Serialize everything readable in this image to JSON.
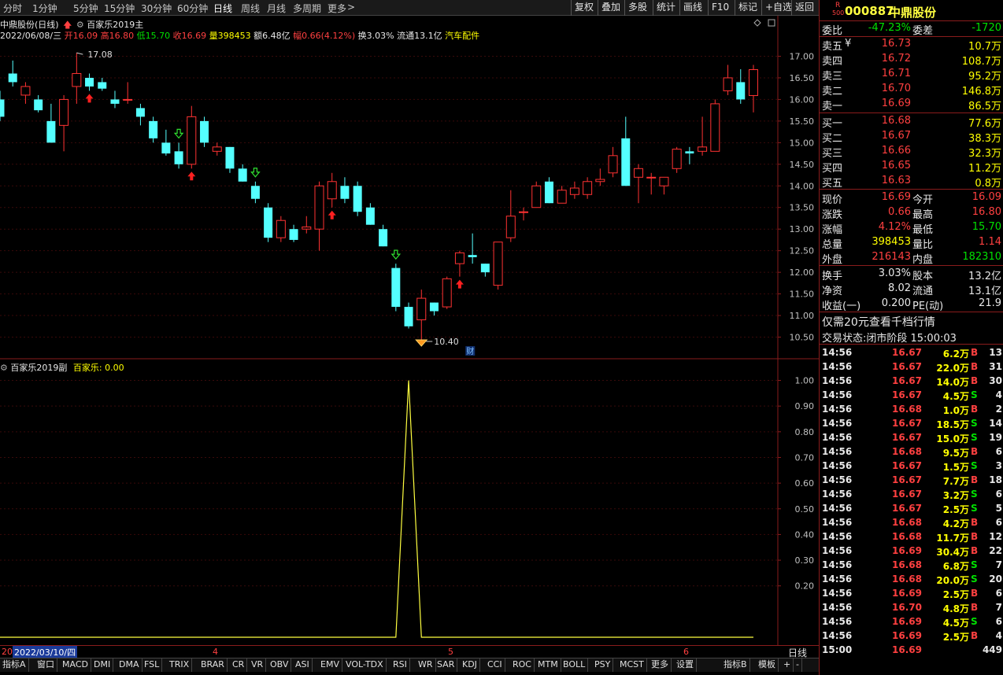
{
  "toolbar": {
    "timeframes": [
      "分时",
      "1分钟",
      "5分钟",
      "15分钟",
      "30分钟",
      "60分钟",
      "日线",
      "周线",
      "月线",
      "多周期",
      "更多"
    ],
    "active": "日线",
    "more_arrow": ">",
    "right_buttons": [
      "复权",
      "叠加",
      "多股",
      "统计",
      "画线",
      "F10",
      "标记",
      "+自选",
      "返回"
    ]
  },
  "info": {
    "title": "中鼎股份(日线)",
    "indicator_main": "百家乐2019主",
    "date": "2022/06/08/三",
    "open": "开16.09",
    "high": "高16.80",
    "low": "低15.70",
    "close": "收16.69",
    "volume": "量398453",
    "amount": "额6.48亿",
    "amplitude": "幅0.66(4.12%)",
    "turnover": "换3.03%",
    "float": "流通13.1亿",
    "sector": "汽车配件"
  },
  "chart_data": [
    {
      "type": "candlestick",
      "y_axis_labels": [
        "17.00",
        "16.50",
        "16.00",
        "15.50",
        "15.00",
        "14.50",
        "14.00",
        "13.50",
        "13.00",
        "12.50",
        "12.00",
        "11.50",
        "11.00",
        "10.50"
      ],
      "ylim": [
        10.2,
        17.3
      ],
      "annotations": {
        "high_label": "17.08",
        "low_label": "10.40",
        "fin_marker": "财"
      },
      "colors": {
        "up": "#ff3232",
        "down": "#54ffff"
      },
      "candles": [
        {
          "o": 16.0,
          "h": 16.2,
          "l": 15.5,
          "c": 15.6
        },
        {
          "o": 16.6,
          "h": 16.9,
          "l": 16.3,
          "c": 16.4
        },
        {
          "o": 16.1,
          "h": 16.4,
          "l": 15.9,
          "c": 16.3
        },
        {
          "o": 16.0,
          "h": 16.1,
          "l": 15.7,
          "c": 15.75
        },
        {
          "o": 15.5,
          "h": 15.9,
          "l": 15.0,
          "c": 15.0
        },
        {
          "o": 15.4,
          "h": 16.1,
          "l": 14.8,
          "c": 16.0
        },
        {
          "o": 16.3,
          "h": 17.08,
          "l": 15.9,
          "c": 16.6
        },
        {
          "o": 16.5,
          "h": 16.6,
          "l": 16.2,
          "c": 16.3
        },
        {
          "o": 16.4,
          "h": 16.5,
          "l": 16.2,
          "c": 16.25
        },
        {
          "o": 16.0,
          "h": 16.2,
          "l": 15.8,
          "c": 15.9
        },
        {
          "o": 16.0,
          "h": 16.4,
          "l": 15.9,
          "c": 16.0
        },
        {
          "o": 15.8,
          "h": 15.9,
          "l": 15.4,
          "c": 15.6
        },
        {
          "o": 15.5,
          "h": 15.6,
          "l": 15.0,
          "c": 15.1
        },
        {
          "o": 15.0,
          "h": 15.3,
          "l": 14.7,
          "c": 14.75
        },
        {
          "o": 14.8,
          "h": 15.0,
          "l": 14.4,
          "c": 14.5
        },
        {
          "o": 14.5,
          "h": 15.85,
          "l": 14.4,
          "c": 15.6
        },
        {
          "o": 15.5,
          "h": 15.6,
          "l": 14.9,
          "c": 15.0
        },
        {
          "o": 14.8,
          "h": 15.0,
          "l": 14.7,
          "c": 14.9
        },
        {
          "o": 14.9,
          "h": 14.9,
          "l": 14.3,
          "c": 14.4
        },
        {
          "o": 14.4,
          "h": 14.5,
          "l": 14.1,
          "c": 14.1
        },
        {
          "o": 14.0,
          "h": 14.1,
          "l": 13.6,
          "c": 13.7
        },
        {
          "o": 13.5,
          "h": 13.6,
          "l": 12.7,
          "c": 12.8
        },
        {
          "o": 12.8,
          "h": 13.3,
          "l": 12.7,
          "c": 13.2
        },
        {
          "o": 13.0,
          "h": 13.1,
          "l": 12.7,
          "c": 12.75
        },
        {
          "o": 13.0,
          "h": 13.3,
          "l": 12.9,
          "c": 13.05
        },
        {
          "o": 13.0,
          "h": 14.1,
          "l": 12.5,
          "c": 14.0
        },
        {
          "o": 13.7,
          "h": 14.3,
          "l": 13.5,
          "c": 14.1
        },
        {
          "o": 14.0,
          "h": 14.2,
          "l": 13.6,
          "c": 13.7
        },
        {
          "o": 14.0,
          "h": 14.1,
          "l": 13.3,
          "c": 13.4
        },
        {
          "o": 13.5,
          "h": 13.6,
          "l": 13.1,
          "c": 13.1
        },
        {
          "o": 13.0,
          "h": 13.1,
          "l": 12.6,
          "c": 12.6
        },
        {
          "o": 12.1,
          "h": 12.2,
          "l": 11.1,
          "c": 11.2
        },
        {
          "o": 11.2,
          "h": 11.3,
          "l": 10.7,
          "c": 10.75
        },
        {
          "o": 10.9,
          "h": 11.6,
          "l": 10.4,
          "c": 11.4
        },
        {
          "o": 11.3,
          "h": 11.3,
          "l": 11.0,
          "c": 11.1
        },
        {
          "o": 11.2,
          "h": 11.9,
          "l": 11.15,
          "c": 11.85
        },
        {
          "o": 12.2,
          "h": 12.5,
          "l": 11.9,
          "c": 12.45
        },
        {
          "o": 12.4,
          "h": 12.9,
          "l": 12.2,
          "c": 12.35
        },
        {
          "o": 12.2,
          "h": 12.2,
          "l": 11.9,
          "c": 12.0
        },
        {
          "o": 11.7,
          "h": 12.7,
          "l": 11.6,
          "c": 12.7
        },
        {
          "o": 12.8,
          "h": 13.9,
          "l": 12.7,
          "c": 13.3
        },
        {
          "o": 13.4,
          "h": 13.5,
          "l": 13.2,
          "c": 13.4
        },
        {
          "o": 13.5,
          "h": 14.1,
          "l": 13.5,
          "c": 14.0
        },
        {
          "o": 14.1,
          "h": 14.2,
          "l": 13.6,
          "c": 13.6
        },
        {
          "o": 13.6,
          "h": 14.0,
          "l": 13.6,
          "c": 13.9
        },
        {
          "o": 13.8,
          "h": 14.1,
          "l": 13.7,
          "c": 13.95
        },
        {
          "o": 13.8,
          "h": 14.2,
          "l": 13.7,
          "c": 14.1
        },
        {
          "o": 14.1,
          "h": 14.4,
          "l": 14.0,
          "c": 14.15
        },
        {
          "o": 14.3,
          "h": 14.9,
          "l": 14.2,
          "c": 14.7
        },
        {
          "o": 15.1,
          "h": 15.6,
          "l": 14.0,
          "c": 14.0
        },
        {
          "o": 14.2,
          "h": 14.5,
          "l": 13.6,
          "c": 14.4
        },
        {
          "o": 14.2,
          "h": 14.3,
          "l": 13.8,
          "c": 14.2
        },
        {
          "o": 14.0,
          "h": 14.2,
          "l": 13.8,
          "c": 14.2
        },
        {
          "o": 14.4,
          "h": 14.9,
          "l": 14.3,
          "c": 14.85
        },
        {
          "o": 14.8,
          "h": 14.9,
          "l": 14.5,
          "c": 14.75
        },
        {
          "o": 14.8,
          "h": 15.6,
          "l": 14.7,
          "c": 14.9
        },
        {
          "o": 14.8,
          "h": 16.0,
          "l": 14.8,
          "c": 15.9
        },
        {
          "o": 16.2,
          "h": 16.8,
          "l": 16.1,
          "c": 16.5
        },
        {
          "o": 16.4,
          "h": 16.7,
          "l": 15.9,
          "c": 16.0
        },
        {
          "o": 16.09,
          "h": 16.8,
          "l": 15.7,
          "c": 16.69
        }
      ],
      "signals": [
        {
          "i": 7,
          "kind": "up"
        },
        {
          "i": 14,
          "kind": "down"
        },
        {
          "i": 15,
          "kind": "up"
        },
        {
          "i": 20,
          "kind": "down"
        },
        {
          "i": 26,
          "kind": "up"
        },
        {
          "i": 31,
          "kind": "down"
        },
        {
          "i": 36,
          "kind": "up"
        }
      ]
    },
    {
      "type": "line",
      "title": "百家乐2019副",
      "series": [
        {
          "name": "百家乐",
          "label": "百家乐: 0.00",
          "color": "#ffff40",
          "peak_index": 32,
          "peak_value": 1.0
        }
      ],
      "y_axis_labels": [
        "1.00",
        "0.90",
        "0.80",
        "0.70",
        "0.60",
        "0.50",
        "0.40",
        "0.30",
        "0.20"
      ],
      "ylim": [
        0,
        1.02
      ]
    }
  ],
  "date_bar": {
    "start_prefix": "20",
    "cursor_date": "2022/03/10/四",
    "months": [
      "4",
      "5",
      "6"
    ],
    "period": "日线"
  },
  "tabs": [
    "指标A",
    "窗口",
    "MACD",
    "DMI",
    "DMA",
    "FSL",
    "TRIX",
    "BRAR",
    "CR",
    "VR",
    "OBV",
    "ASI",
    "EMV",
    "VOL-TDX",
    "RSI",
    "WR",
    "SAR",
    "KDJ",
    "CCI",
    "ROC",
    "MTM",
    "BOLL",
    "PSY",
    "MCST",
    "更多",
    "设置",
    "指标B",
    "模板",
    "+",
    "-"
  ],
  "quote": {
    "r_badge": "R",
    "r_sub": "500",
    "code": "000887",
    "name": "中鼎股份",
    "webi": {
      "label": "委比",
      "value": "-47.23%",
      "cha_label": "委差",
      "cha": "-1720"
    },
    "sells": [
      {
        "label": "卖五",
        "mark": "¥",
        "price": "16.73",
        "vol": "10.7万"
      },
      {
        "label": "卖四",
        "price": "16.72",
        "vol": "108.7万"
      },
      {
        "label": "卖三",
        "price": "16.71",
        "vol": "95.2万"
      },
      {
        "label": "卖二",
        "price": "16.70",
        "vol": "146.8万"
      },
      {
        "label": "卖一",
        "price": "16.69",
        "vol": "86.5万"
      }
    ],
    "buys": [
      {
        "label": "买一",
        "price": "16.68",
        "vol": "77.6万"
      },
      {
        "label": "买二",
        "price": "16.67",
        "vol": "38.3万"
      },
      {
        "label": "买三",
        "price": "16.66",
        "vol": "32.3万"
      },
      {
        "label": "买四",
        "price": "16.65",
        "vol": "11.2万"
      },
      {
        "label": "买五",
        "price": "16.63",
        "vol": "0.8万"
      }
    ],
    "stats": [
      {
        "l1": "现价",
        "v1": "16.69",
        "l2": "今开",
        "v2": "16.09"
      },
      {
        "l1": "涨跌",
        "v1": "0.66",
        "l2": "最高",
        "v2": "16.80"
      },
      {
        "l1": "涨幅",
        "v1": "4.12%",
        "l2": "最低",
        "v2": "15.70"
      },
      {
        "l1": "总量",
        "v1": "398453",
        "l2": "量比",
        "v2": "1.14"
      },
      {
        "l1": "外盘",
        "v1": "216143",
        "l2": "内盘",
        "v2": "182310"
      }
    ],
    "stats2": [
      {
        "l1": "换手",
        "v1": "3.03%",
        "l2": "股本",
        "v2": "13.2亿"
      },
      {
        "l1": "净资",
        "v1": "8.02",
        "l2": "流通",
        "v2": "13.1亿"
      },
      {
        "l1": "收益(一)",
        "v1": "0.200",
        "l2": "PE(动)",
        "v2": "21.9"
      }
    ],
    "promo": "仅需20元查看千档行情",
    "status": "交易状态:闭市阶段 15:00:03"
  },
  "ticks": [
    {
      "t": "14:56",
      "p": "16.67",
      "v": "6.2万",
      "d": "B",
      "n": "13"
    },
    {
      "t": "14:56",
      "p": "16.67",
      "v": "22.0万",
      "d": "B",
      "n": "31"
    },
    {
      "t": "14:56",
      "p": "16.67",
      "v": "14.0万",
      "d": "B",
      "n": "30"
    },
    {
      "t": "14:56",
      "p": "16.67",
      "v": "4.5万",
      "d": "S",
      "n": "4"
    },
    {
      "t": "14:56",
      "p": "16.68",
      "v": "1.0万",
      "d": "B",
      "n": "2"
    },
    {
      "t": "14:56",
      "p": "16.67",
      "v": "18.5万",
      "d": "S",
      "n": "14"
    },
    {
      "t": "14:56",
      "p": "16.67",
      "v": "15.0万",
      "d": "S",
      "n": "19"
    },
    {
      "t": "14:56",
      "p": "16.68",
      "v": "9.5万",
      "d": "B",
      "n": "6"
    },
    {
      "t": "14:56",
      "p": "16.67",
      "v": "1.5万",
      "d": "S",
      "n": "3"
    },
    {
      "t": "14:56",
      "p": "16.67",
      "v": "7.7万",
      "d": "B",
      "n": "18"
    },
    {
      "t": "14:56",
      "p": "16.67",
      "v": "3.2万",
      "d": "S",
      "n": "6"
    },
    {
      "t": "14:56",
      "p": "16.67",
      "v": "2.5万",
      "d": "S",
      "n": "5"
    },
    {
      "t": "14:56",
      "p": "16.68",
      "v": "4.2万",
      "d": "B",
      "n": "6"
    },
    {
      "t": "14:56",
      "p": "16.68",
      "v": "11.7万",
      "d": "B",
      "n": "12"
    },
    {
      "t": "14:56",
      "p": "16.69",
      "v": "30.4万",
      "d": "B",
      "n": "22"
    },
    {
      "t": "14:56",
      "p": "16.68",
      "v": "6.8万",
      "d": "S",
      "n": "7"
    },
    {
      "t": "14:56",
      "p": "16.68",
      "v": "20.0万",
      "d": "S",
      "n": "20"
    },
    {
      "t": "14:56",
      "p": "16.69",
      "v": "2.5万",
      "d": "B",
      "n": "6"
    },
    {
      "t": "14:56",
      "p": "16.70",
      "v": "4.8万",
      "d": "B",
      "n": "7"
    },
    {
      "t": "14:56",
      "p": "16.69",
      "v": "4.5万",
      "d": "S",
      "n": "6"
    },
    {
      "t": "14:56",
      "p": "16.69",
      "v": "2.5万",
      "d": "B",
      "n": "4"
    },
    {
      "t": "15:00",
      "p": "16.69",
      "v": "",
      "d": "",
      "n": "449"
    }
  ]
}
